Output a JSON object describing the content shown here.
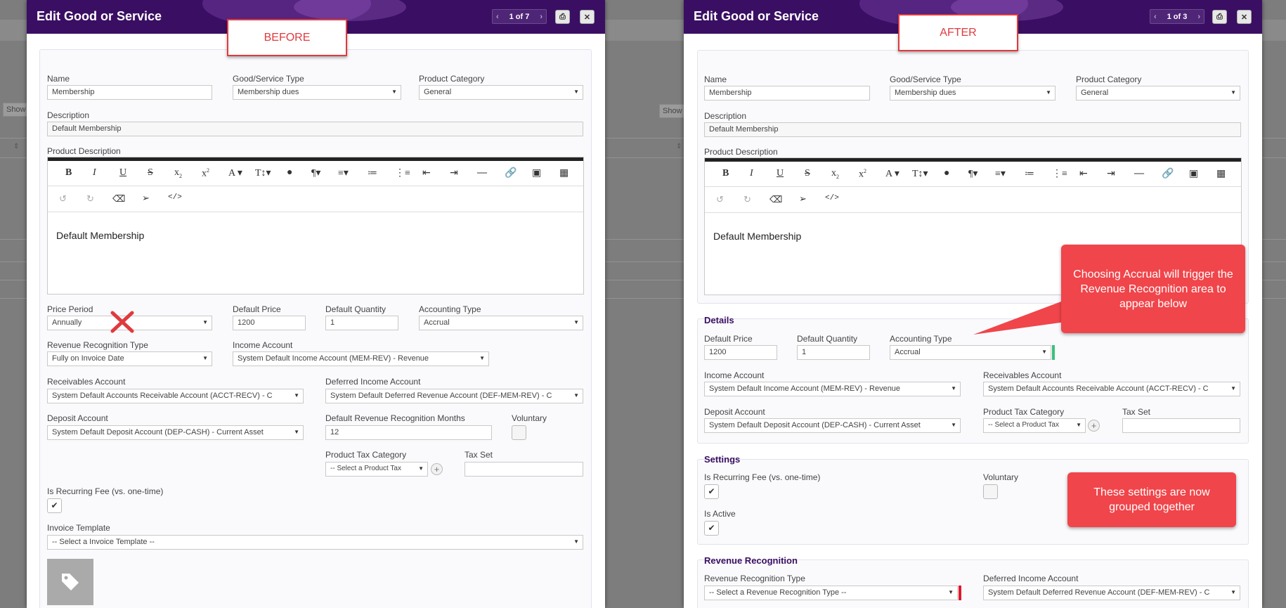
{
  "background": {
    "show_label": "Show"
  },
  "before": {
    "title": "Edit Good or Service",
    "pager": "1 of 7",
    "annotation": "BEFORE",
    "name_label": "Name",
    "name_value": "Membership",
    "type_label": "Good/Service Type",
    "type_value": "Membership dues",
    "category_label": "Product Category",
    "category_value": "General",
    "description_label": "Description",
    "description_value": "Default Membership",
    "product_description_label": "Product Description",
    "editor_text": "Default Membership",
    "price_period_label": "Price Period",
    "price_period_value": "Annually",
    "default_price_label": "Default Price",
    "default_price_value": "1200",
    "default_qty_label": "Default Quantity",
    "default_qty_value": "1",
    "accounting_type_label": "Accounting Type",
    "accounting_type_value": "Accrual",
    "rev_rec_type_label": "Revenue Recognition Type",
    "rev_rec_type_value": "Fully on Invoice Date",
    "income_account_label": "Income Account",
    "income_account_value": "System Default Income Account (MEM-REV) - Revenue",
    "receivables_label": "Receivables Account",
    "receivables_value": "System Default Accounts Receivable Account (ACCT-RECV) - C",
    "deferred_label": "Deferred Income Account",
    "deferred_value": "System Default Deferred Revenue Account (DEF-MEM-REV) - C",
    "deposit_label": "Deposit Account",
    "deposit_value": "System Default Deposit Account (DEP-CASH) - Current Asset",
    "rev_months_label": "Default Revenue Recognition Months",
    "rev_months_value": "12",
    "voluntary_label": "Voluntary",
    "tax_category_label": "Product Tax Category",
    "tax_category_value": "-- Select a Product Tax",
    "tax_set_label": "Tax Set",
    "recurring_label": "Is Recurring Fee (vs. one-time)",
    "invoice_template_label": "Invoice Template",
    "invoice_template_value": "-- Select a Invoice Template --"
  },
  "after": {
    "title": "Edit Good or Service",
    "pager": "1 of 3",
    "annotation": "AFTER",
    "name_label": "Name",
    "name_value": "Membership",
    "type_label": "Good/Service Type",
    "type_value": "Membership dues",
    "category_label": "Product Category",
    "category_value": "General",
    "description_label": "Description",
    "description_value": "Default Membership",
    "product_description_label": "Product Description",
    "editor_text": "Default Membership",
    "details_title": "Details",
    "default_price_label": "Default Price",
    "default_price_value": "1200",
    "default_qty_label": "Default Quantity",
    "default_qty_value": "1",
    "accounting_type_label": "Accounting Type",
    "accounting_type_value": "Accrual",
    "income_account_label": "Income Account",
    "income_account_value": "System Default Income Account (MEM-REV) - Revenue",
    "receivables_label": "Receivables Account",
    "receivables_value": "System Default Accounts Receivable Account (ACCT-RECV) - C",
    "deposit_label": "Deposit Account",
    "deposit_value": "System Default Deposit Account (DEP-CASH) - Current Asset",
    "tax_category_label": "Product Tax Category",
    "tax_category_value": "-- Select a Product Tax",
    "tax_set_label": "Tax Set",
    "settings_title": "Settings",
    "recurring_label": "Is Recurring Fee (vs. one-time)",
    "voluntary_label": "Voluntary",
    "is_active_label": "Is Active",
    "rev_rec_title": "Revenue Recognition",
    "rev_rec_type_label": "Revenue Recognition Type",
    "rev_rec_type_value": "-- Select a Revenue Recognition Type --",
    "deferred_label": "Deferred Income Account",
    "deferred_value": "System Default Deferred Revenue Account (DEF-MEM-REV) - C",
    "callout_accrual": "Choosing Accrual will trigger the Revenue Recognition area to appear below",
    "callout_settings": "These settings are now grouped together"
  },
  "colors": {
    "header": "#3a0f63",
    "annotation_red": "#e03a3e",
    "callout": "#f0454a",
    "required": "#e0192c",
    "valid": "#3cc07a"
  }
}
